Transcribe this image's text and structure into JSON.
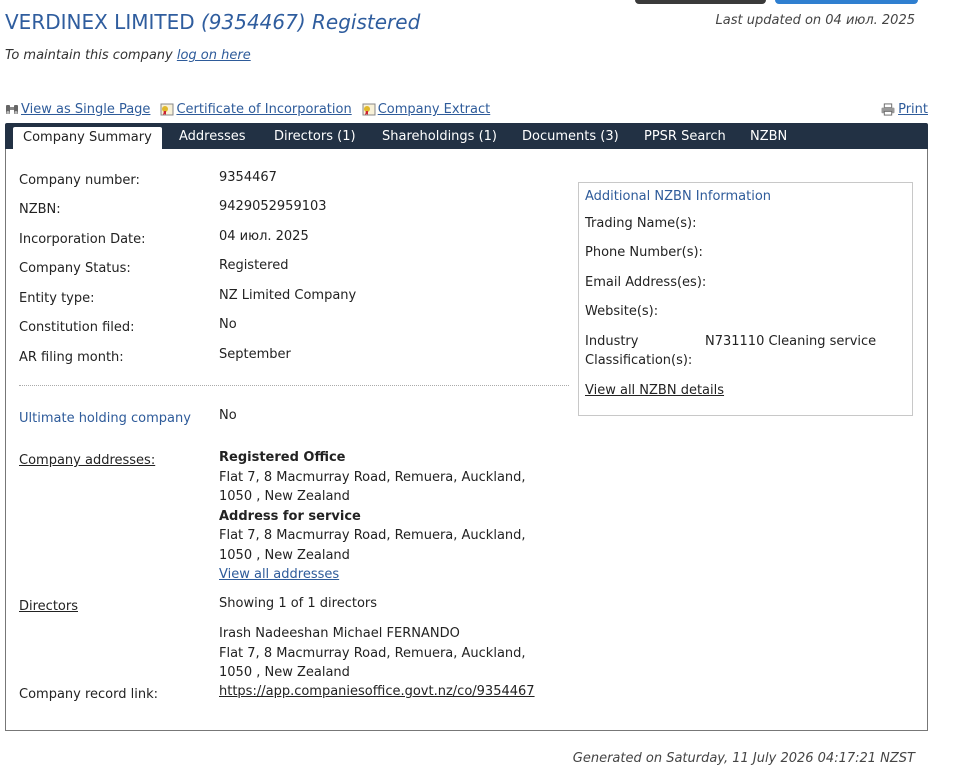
{
  "header": {
    "company_name": "VERDINEX LIMITED",
    "company_number_paren": "(9354467)",
    "status": "Registered",
    "last_updated": "Last updated on 04 июл. 2025",
    "maintain_text": "To maintain this company",
    "logon_link": "log on here"
  },
  "actions": {
    "single_page": "View as Single Page",
    "certificate": "Certificate of Incorporation",
    "extract": "Company Extract",
    "print": "Print"
  },
  "tabs": [
    {
      "label": "Company Summary"
    },
    {
      "label": "Addresses"
    },
    {
      "label": "Directors (1)"
    },
    {
      "label": "Shareholdings (1)"
    },
    {
      "label": "Documents (3)"
    },
    {
      "label": "PPSR Search"
    },
    {
      "label": "NZBN"
    }
  ],
  "summary": {
    "company_number_label": "Company number:",
    "company_number": "9354467",
    "nzbn_label": "NZBN:",
    "nzbn": "9429052959103",
    "incorporation_label": "Incorporation Date:",
    "incorporation_date": "04 июл. 2025",
    "status_label": "Company Status:",
    "status": "Registered",
    "entity_label": "Entity type:",
    "entity_type": "NZ Limited Company",
    "constitution_label": "Constitution filed:",
    "constitution": "No",
    "ar_label": "AR filing month:",
    "ar_month": "September",
    "uhc_label": "Ultimate holding company",
    "uhc_value": "No",
    "addresses_label": "Company addresses:",
    "registered_office_title": "Registered Office",
    "registered_office_line1": "Flat 7, 8 Macmurray Road, Remuera, Auckland,",
    "registered_office_line2": "1050 , New Zealand",
    "service_title": "Address for service",
    "service_line1": "Flat 7, 8 Macmurray Road, Remuera, Auckland,",
    "service_line2": "1050 , New Zealand",
    "view_all_addresses": "View all addresses",
    "directors_label": "Directors",
    "directors_showing": "Showing 1 of 1 directors",
    "director_name": "Irash Nadeeshan Michael FERNANDO",
    "director_line1": "Flat 7, 8 Macmurray Road, Remuera, Auckland,",
    "director_line2": "1050 , New Zealand",
    "record_link_label": "Company record link:",
    "record_link": "https://app.companiesoffice.govt.nz/co/9354467"
  },
  "nzbn_info": {
    "title": "Additional NZBN Information",
    "trading_label": "Trading Name(s):",
    "phone_label": "Phone Number(s):",
    "email_label": "Email Address(es):",
    "website_label": "Website(s):",
    "industry_label_1": "Industry",
    "industry_label_2": "Classification(s):",
    "industry_value": "N731110 Cleaning service",
    "view_all": "View all NZBN details"
  },
  "footer": {
    "generated": "Generated on Saturday, 11 July 2026 04:17:21 NZST"
  },
  "colors": {
    "title_blue": "#2f5d9e",
    "link_blue": "#2e5b9a",
    "tab_bar": "#223144"
  }
}
